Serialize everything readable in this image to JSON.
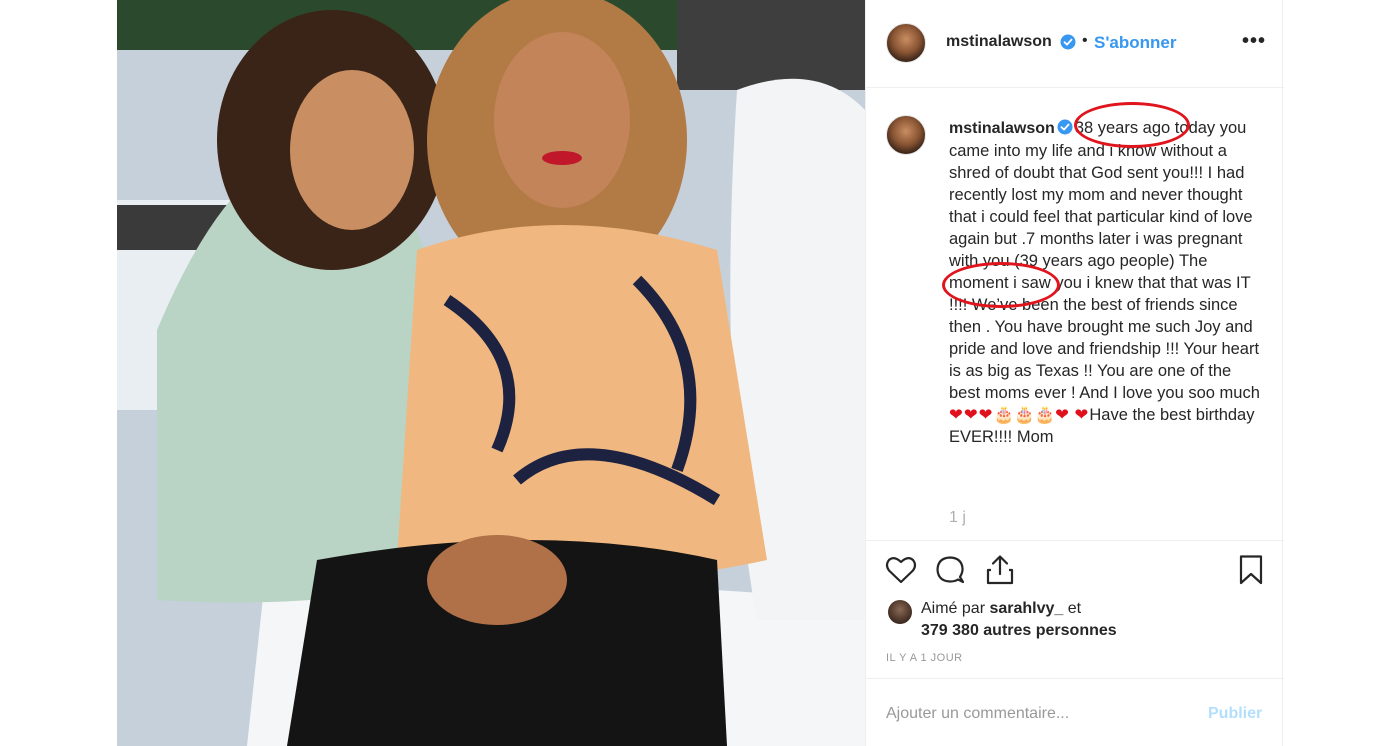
{
  "post": {
    "username": "mstinalawson",
    "follow_label": "S'abonner",
    "more_label": "•••"
  },
  "caption": {
    "username": "mstinalawson",
    "text_before_1": " ",
    "circled_1": "38 years ago",
    "text_mid": " today you came into my life and i know without a shred of doubt that God sent you!!! I had recently lost my mom and never thought that i could feel that particular kind of love again but .7 months later i was pregnant with you ",
    "circled_2": "(39 years ago",
    "text_after": " people) The moment i saw you i knew that that was IT !!!! We’ve been the best of friends since then . You have brought me such Joy and pride and love and friendship !!! Your heart is as big as Texas !! You are one of the best moms ever ! And I love you soo much ",
    "hearts_1": "❤❤❤",
    "cakes": "🎂🎂🎂",
    "hearts_2": "❤",
    "hearts_3": "❤",
    "ending": "Have the best birthday EVER!!!! Mom",
    "time_relative": "1 j"
  },
  "likes": {
    "prefix": "Aimé par ",
    "user": "sarahlvy_",
    "suffix": " et",
    "others": "379 380 autres personnes"
  },
  "timestamp": "IL Y A 1 JOUR",
  "comment": {
    "placeholder": "Ajouter un commentaire...",
    "publish_label": "Publier"
  },
  "colors": {
    "link_blue": "#3897f0",
    "publish_disabled": "#b2dffc",
    "annotation_red": "#e0141c"
  },
  "icons": [
    "heart-icon",
    "comment-icon",
    "share-icon",
    "bookmark-icon",
    "verified-badge-icon",
    "more-icon"
  ]
}
